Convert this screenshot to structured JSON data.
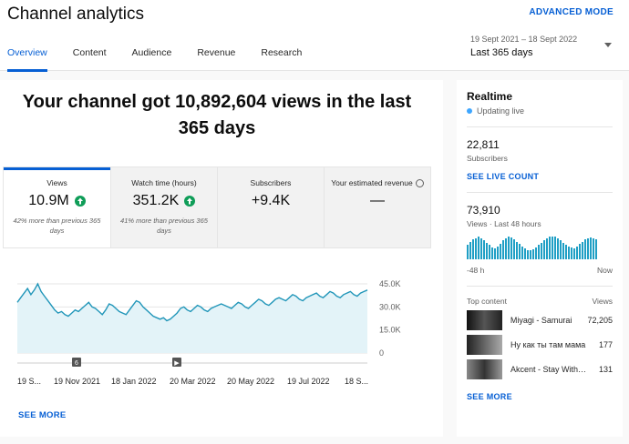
{
  "header": {
    "title": "Channel analytics",
    "advanced_mode": "ADVANCED MODE",
    "tabs": [
      "Overview",
      "Content",
      "Audience",
      "Revenue",
      "Research"
    ],
    "date_range_sub": "19 Sept 2021 – 18 Sept 2022",
    "date_range_main": "Last 365 days"
  },
  "overview": {
    "headline": "Your channel got 10,892,604 views in the last 365 days",
    "metrics": [
      {
        "label": "Views",
        "value": "10.9M",
        "note": "42% more than previous 365 days"
      },
      {
        "label": "Watch time (hours)",
        "value": "351.2K",
        "note": "41% more than previous 365 days"
      },
      {
        "label": "Subscribers",
        "value": "+9.4K",
        "note": ""
      },
      {
        "label": "Your estimated revenue",
        "value": "—",
        "note": ""
      }
    ],
    "see_more": "SEE MORE"
  },
  "chart_data": {
    "type": "area",
    "title": "",
    "xlabel": "",
    "ylabel": "",
    "ylim": [
      0,
      45000
    ],
    "yticks": [
      "45.0K",
      "30.0K",
      "15.0K",
      "0"
    ],
    "xticks": [
      "19 S...",
      "19 Nov 2021",
      "18 Jan 2022",
      "20 Mar 2022",
      "20 May 2022",
      "19 Jul 2022",
      "18 S..."
    ],
    "markers": [
      {
        "label": "6"
      },
      {
        "label": "▶"
      }
    ],
    "values": [
      33000,
      36000,
      39000,
      42000,
      38000,
      41000,
      45000,
      40000,
      37000,
      34000,
      31000,
      28000,
      26000,
      27000,
      25000,
      24000,
      26000,
      28000,
      27000,
      29000,
      31000,
      33000,
      30000,
      29000,
      27000,
      25000,
      28000,
      32000,
      31000,
      29000,
      27000,
      26000,
      25000,
      28000,
      31000,
      34000,
      33000,
      30000,
      28000,
      26000,
      24000,
      23000,
      22000,
      23000,
      21000,
      22000,
      24000,
      26000,
      29000,
      30000,
      28000,
      27000,
      29000,
      31000,
      30000,
      28000,
      27000,
      29000,
      30000,
      31000,
      32000,
      31000,
      30000,
      29000,
      31000,
      33000,
      32000,
      30000,
      29000,
      31000,
      33000,
      35000,
      34000,
      32000,
      31000,
      33000,
      35000,
      36000,
      35000,
      34000,
      36000,
      38000,
      37000,
      35000,
      34000,
      36000,
      37000,
      38000,
      39000,
      37000,
      36000,
      38000,
      40000,
      39000,
      37000,
      36000,
      38000,
      39000,
      40000,
      38000,
      37000,
      39000,
      40000,
      41000
    ]
  },
  "realtime": {
    "title": "Realtime",
    "status": "Updating live",
    "subscribers_value": "22,811",
    "subscribers_label": "Subscribers",
    "see_live": "SEE LIVE COUNT",
    "views_value": "73,910",
    "views_label": "Views · Last 48 hours",
    "axis_left": "-48 h",
    "axis_right": "Now",
    "hourly_views": [
      60,
      75,
      85,
      90,
      95,
      88,
      80,
      70,
      60,
      50,
      45,
      55,
      65,
      80,
      90,
      95,
      92,
      85,
      75,
      65,
      55,
      45,
      40,
      38,
      42,
      50,
      60,
      70,
      80,
      90,
      95,
      98,
      95,
      88,
      80,
      70,
      60,
      55,
      50,
      48,
      55,
      65,
      75,
      85,
      90,
      94,
      90,
      85
    ],
    "top_content_label": "Top content",
    "top_content_views_label": "Views",
    "top_content": [
      {
        "title": "Miyagi - Samurai",
        "views": "72,205"
      },
      {
        "title": "Ну как ты там мама",
        "views": "177"
      },
      {
        "title": "Akcent - Stay With Me",
        "views": "131"
      }
    ],
    "see_more": "SEE MORE"
  }
}
